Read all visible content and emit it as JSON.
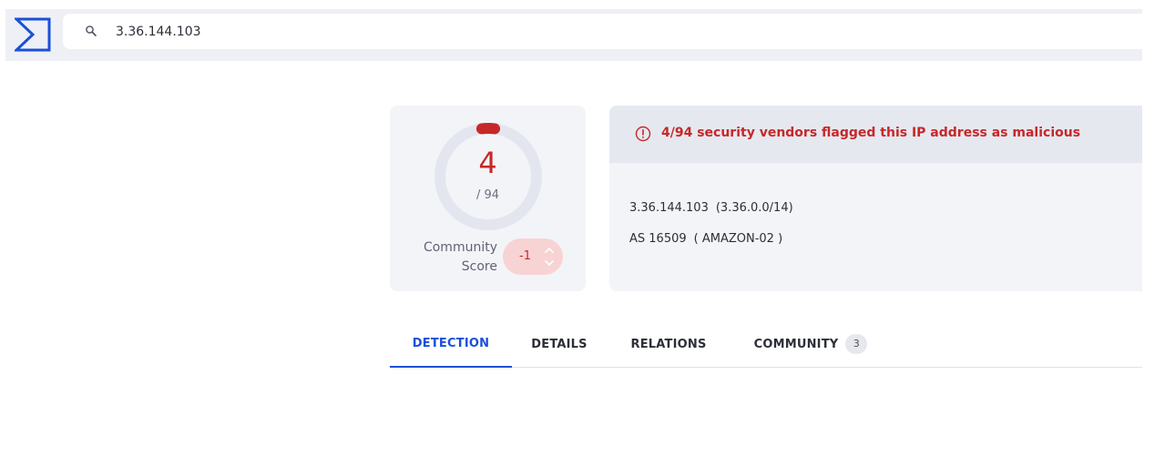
{
  "search": {
    "value": "3.36.144.103"
  },
  "score": {
    "detected": "4",
    "total": "/ 94",
    "fraction_flagged": 0.0426,
    "color": "#c62828"
  },
  "community": {
    "label_line1": "Community",
    "label_line2": "Score",
    "value": "-1"
  },
  "alert": {
    "text": "4/94 security vendors flagged this IP address as malicious"
  },
  "ip_info": {
    "ip": "3.36.144.103",
    "range": "(3.36.0.0/14)",
    "as_number": "AS 16509",
    "as_owner": "( AMAZON-02 )"
  },
  "tabs": [
    {
      "label": "DETECTION",
      "active": true
    },
    {
      "label": "DETAILS"
    },
    {
      "label": "RELATIONS"
    },
    {
      "label": "COMMUNITY",
      "count": "3"
    }
  ],
  "colors": {
    "accent": "#1c4fd8",
    "malicious": "#c62828"
  }
}
